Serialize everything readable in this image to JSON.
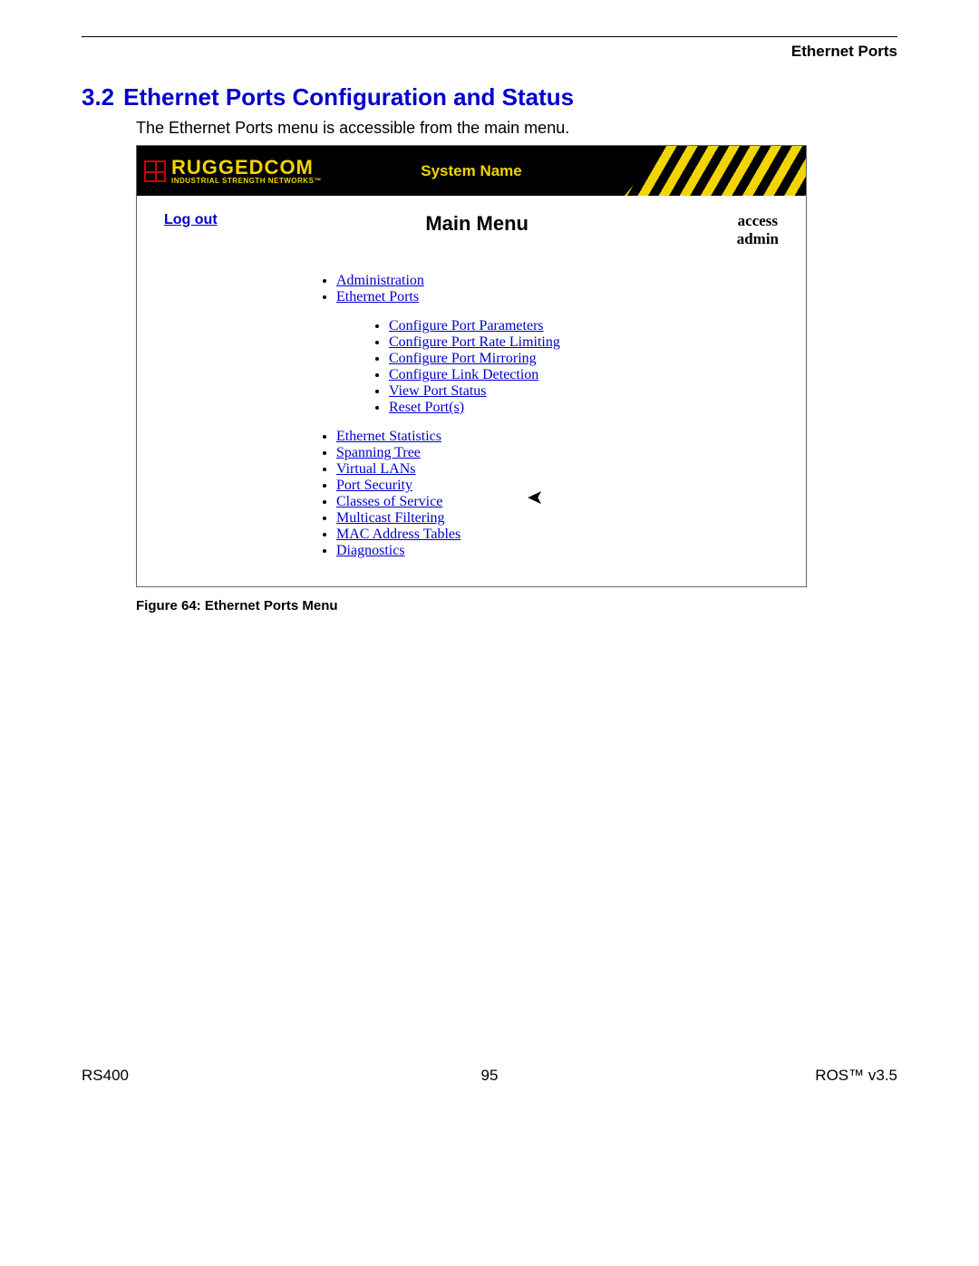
{
  "header": {
    "label": "Ethernet Ports"
  },
  "section": {
    "number": "3.2",
    "title": "Ethernet Ports Configuration and Status",
    "intro": "The Ethernet Ports menu is accessible from the main menu."
  },
  "screenshot": {
    "brand_main": "RUGGEDCOM",
    "brand_sub": "INDUSTRIAL STRENGTH NETWORKS™",
    "system_name": "System Name",
    "logout": "Log out",
    "main_title": "Main Menu",
    "access_line1": "access",
    "access_line2": "admin",
    "menu_top1": "Administration",
    "menu_top2": "Ethernet Ports",
    "submenu": {
      "i0": "Configure Port Parameters",
      "i1": "Configure Port Rate Limiting",
      "i2": "Configure Port Mirroring",
      "i3": "Configure Link Detection",
      "i4": "View Port Status",
      "i5": "Reset Port(s)"
    },
    "menu_rest": {
      "i0": "Ethernet Statistics",
      "i1": "Spanning Tree",
      "i2": "Virtual LANs",
      "i3": "Port Security",
      "i4": "Classes of Service",
      "i5": "Multicast Filtering",
      "i6": "MAC Address Tables",
      "i7": "Diagnostics"
    }
  },
  "figure_caption": "Figure 64: Ethernet Ports Menu",
  "footer": {
    "left": "RS400",
    "center": "95",
    "right": "ROS™  v3.5"
  }
}
